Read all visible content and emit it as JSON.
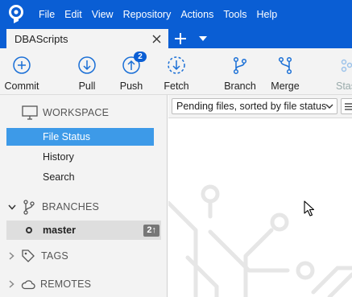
{
  "app": {
    "logo_icon": "sourcetree-logo-icon",
    "menu": [
      "File",
      "Edit",
      "View",
      "Repository",
      "Actions",
      "Tools",
      "Help"
    ]
  },
  "tabs": {
    "active_title": "DBAScripts",
    "close_icon": "close-icon",
    "add_icon": "plus-icon",
    "menu_icon": "chevron-down-icon"
  },
  "toolbar": {
    "commit": "Commit",
    "pull": "Pull",
    "push": "Push",
    "push_badge": "2",
    "fetch": "Fetch",
    "branch": "Branch",
    "merge": "Merge",
    "stash": "Stas"
  },
  "sidebar": {
    "workspace": {
      "header": "WORKSPACE",
      "items": [
        "File Status",
        "History",
        "Search"
      ],
      "selected": "File Status"
    },
    "branches": {
      "header": "BRANCHES",
      "items": [
        {
          "name": "master",
          "ahead": "2↑"
        }
      ]
    },
    "tags": {
      "header": "TAGS"
    },
    "remotes": {
      "header": "REMOTES"
    }
  },
  "main": {
    "sort_label": "Pending files, sorted by file status"
  },
  "colors": {
    "accent": "#0a5ed4",
    "selection": "#3d9ae8",
    "panel": "#f3f3f3",
    "art": "#e5e5e5"
  }
}
